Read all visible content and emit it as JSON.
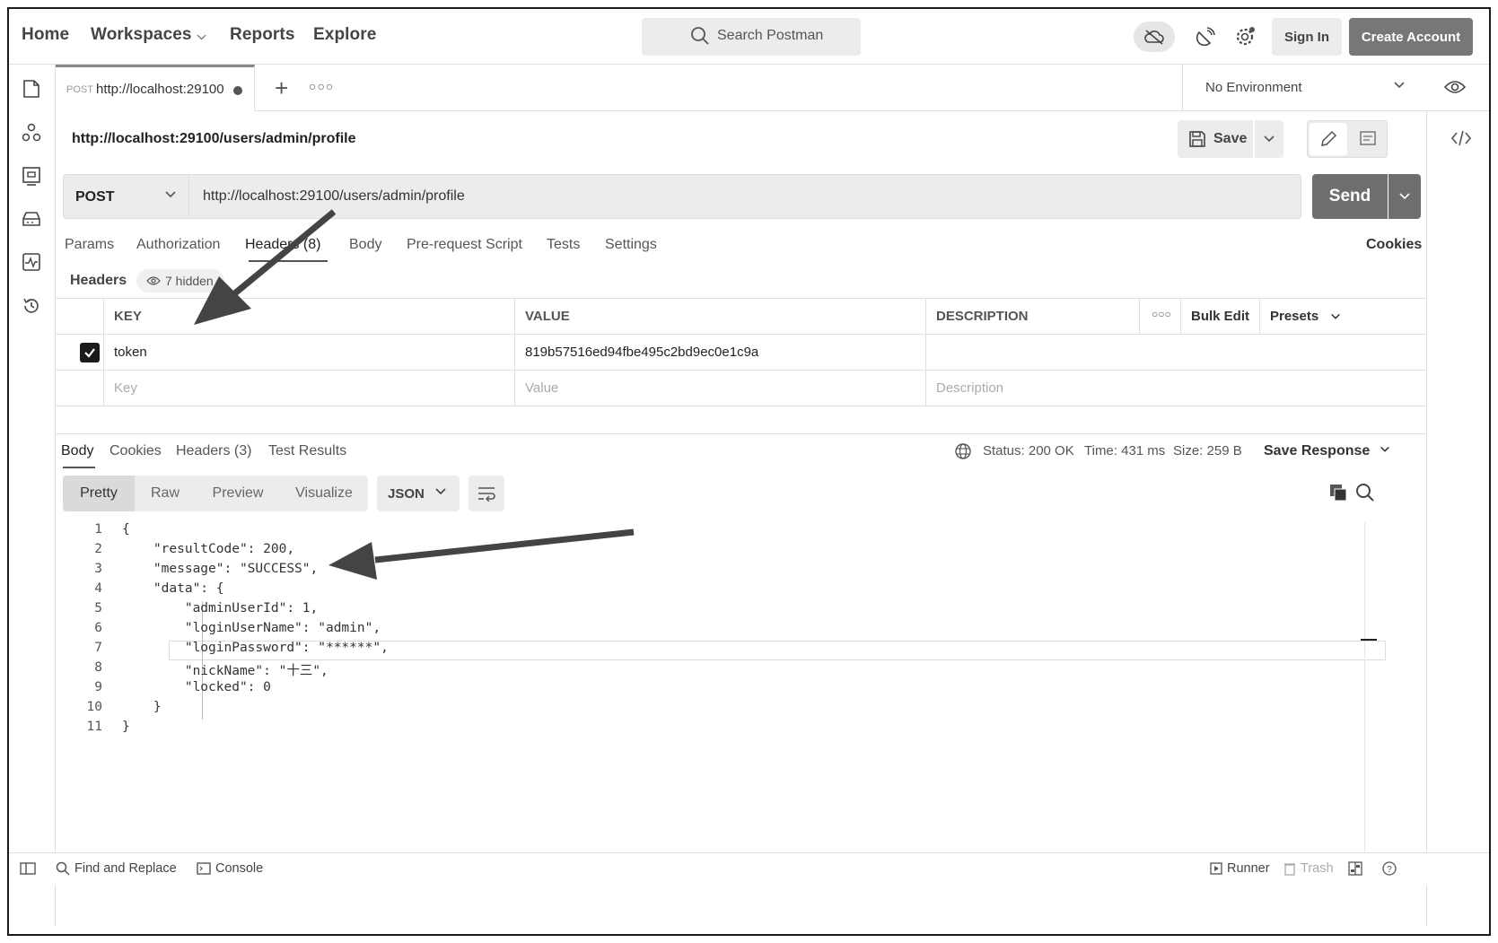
{
  "header": {
    "nav": [
      {
        "label": "Home"
      },
      {
        "label": "Workspaces"
      },
      {
        "label": "Reports"
      },
      {
        "label": "Explore"
      }
    ],
    "search_placeholder": "Search Postman",
    "sign_in": "Sign In",
    "create_account": "Create Account"
  },
  "tab": {
    "method": "POST",
    "title": "http://localhost:29100"
  },
  "environment": "No Environment",
  "request": {
    "title": "http://localhost:29100/users/admin/profile",
    "save_label": "Save",
    "method": "POST",
    "url": "http://localhost:29100/users/admin/profile",
    "send_label": "Send",
    "tabs": [
      "Params",
      "Authorization",
      "Headers (8)",
      "Body",
      "Pre-request Script",
      "Tests",
      "Settings"
    ],
    "cookies_label": "Cookies",
    "headers_label": "Headers",
    "hidden_label": "7 hidden"
  },
  "headers_table": {
    "columns": [
      "KEY",
      "VALUE",
      "DESCRIPTION"
    ],
    "bulk_edit": "Bulk Edit",
    "presets": "Presets",
    "rows": [
      {
        "checked": true,
        "key": "token",
        "value": "819b57516ed94fbe495c2bd9ec0e1c9a",
        "description": ""
      }
    ],
    "placeholder": {
      "key": "Key",
      "value": "Value",
      "description": "Description"
    }
  },
  "response": {
    "tabs": [
      "Body",
      "Cookies",
      "Headers (3)",
      "Test Results"
    ],
    "status": "Status: 200 OK",
    "time": "Time: 431 ms",
    "size": "Size: 259 B",
    "save_response": "Save Response",
    "views": [
      "Pretty",
      "Raw",
      "Preview",
      "Visualize"
    ],
    "format": "JSON",
    "code_lines": [
      "{",
      "    \"resultCode\": 200,",
      "    \"message\": \"SUCCESS\",",
      "    \"data\": {",
      "        \"adminUserId\": 1,",
      "        \"loginUserName\": \"admin\",",
      "        \"loginPassword\": \"******\",",
      "        \"nickName\": \"十三\",",
      "        \"locked\": 0",
      "    }",
      "}"
    ]
  },
  "footer": {
    "find_replace": "Find and Replace",
    "console": "Console",
    "runner": "Runner",
    "trash": "Trash"
  }
}
